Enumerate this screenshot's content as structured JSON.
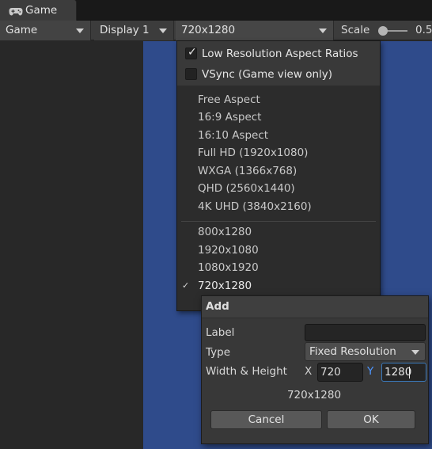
{
  "tab": {
    "label": "Game",
    "icon": "gamepad-icon"
  },
  "toolbar": {
    "view_mode": "Game",
    "display": "Display 1",
    "resolution": "720x1280",
    "scale_label": "Scale",
    "scale_value": "0.5",
    "scale_fraction": 0.1
  },
  "dropdown": {
    "options": [
      {
        "label": "Low Resolution Aspect Ratios",
        "checked": true
      },
      {
        "label": "VSync (Game view only)",
        "checked": false
      }
    ],
    "builtin": [
      "Free Aspect",
      "16:9 Aspect",
      "16:10 Aspect",
      "Full HD (1920x1080)",
      "WXGA (1366x768)",
      "QHD (2560x1440)",
      "4K UHD (3840x2160)"
    ],
    "custom": [
      "800x1280",
      "1920x1080",
      "1080x1920",
      "720x1280"
    ],
    "selected": "720x1280",
    "check_glyph": "✓"
  },
  "add_dialog": {
    "title": "Add",
    "label_field": "Label",
    "label_value": "",
    "type_field": "Type",
    "type_value": "Fixed Resolution",
    "size_field": "Width & Height",
    "x_label": "X",
    "x_value": "720",
    "y_label": "Y",
    "y_value": "1280",
    "preview": "720x1280",
    "cancel": "Cancel",
    "ok": "OK"
  },
  "colors": {
    "viewport_blue": "#2f4b8b",
    "focus_blue": "#3a79bb",
    "y_label_blue": "#4d96ff"
  }
}
